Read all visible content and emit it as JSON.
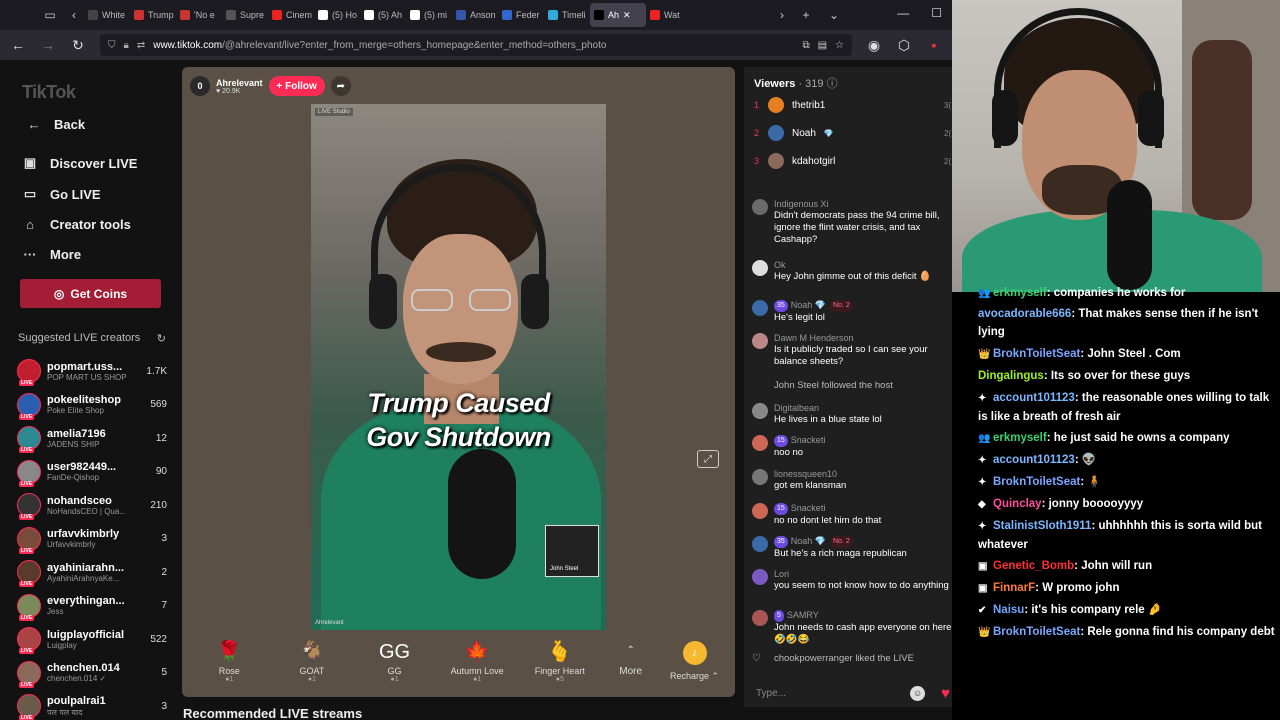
{
  "browser": {
    "tabs": [
      {
        "label": "White",
        "color": "#444"
      },
      {
        "label": "Trump",
        "color": "#c33"
      },
      {
        "label": "'No e",
        "color": "#c33"
      },
      {
        "label": "Supre",
        "color": "#555"
      },
      {
        "label": "Cinem",
        "color": "#e22"
      },
      {
        "label": "(5) Ho",
        "color": "#fff"
      },
      {
        "label": "(5) Ah",
        "color": "#fff"
      },
      {
        "label": "(5) mi",
        "color": "#fff"
      },
      {
        "label": "Anson",
        "color": "#35a"
      },
      {
        "label": "Feder",
        "color": "#36c"
      },
      {
        "label": "Timeli",
        "color": "#3ad"
      },
      {
        "label": "Ah",
        "color": "#000"
      },
      {
        "label": "Wat",
        "color": "#e22"
      }
    ],
    "url_host": "www.tiktok.com",
    "url_path": "/@ahrelevant/live?enter_from_merge=others_homepage&enter_method=others_photo"
  },
  "sidebar": {
    "logo": "TikTok",
    "nav": [
      {
        "label": "Back",
        "icon": "arrow-left-icon",
        "glyph": "←"
      },
      {
        "label": "Discover LIVE",
        "icon": "tv-icon",
        "glyph": "▣"
      },
      {
        "label": "Go LIVE",
        "icon": "camera-icon",
        "glyph": "▭"
      },
      {
        "label": "Creator tools",
        "icon": "house-icon",
        "glyph": "⌂"
      },
      {
        "label": "More",
        "icon": "ellipsis-icon",
        "glyph": "···"
      }
    ],
    "coins_label": "Get Coins",
    "suggested_title": "Suggested LIVE creators",
    "creators": [
      {
        "name": "popmart.uss...",
        "sub": "POP MART US SHOP",
        "count": "1.7K",
        "color": "#c21f2e"
      },
      {
        "name": "pokeeliteshop",
        "sub": "Poke Elite Shop",
        "count": "569",
        "color": "#2a5fb0"
      },
      {
        "name": "amelia7196",
        "sub": "JADENS SHIP",
        "count": "12",
        "color": "#2b8a94"
      },
      {
        "name": "user982449...",
        "sub": "FanDe-Qishop",
        "count": "90",
        "color": "#888"
      },
      {
        "name": "nohandsceo",
        "sub": "NoHandsCEO | Qua...",
        "count": "210",
        "color": "#333"
      },
      {
        "name": "urfavvkimbrly",
        "sub": "Urfavvkimbrly",
        "count": "3",
        "color": "#7a4a3a"
      },
      {
        "name": "ayahiniarahn...",
        "sub": "AyahiniArahnyaKe...",
        "count": "2",
        "color": "#5a3a2a"
      },
      {
        "name": "everythingan...",
        "sub": "Jess",
        "count": "7",
        "color": "#7a8a5a"
      },
      {
        "name": "luigplayofficial",
        "sub": "Luigplay",
        "count": "522",
        "color": "#a44"
      },
      {
        "name": "chenchen.014",
        "sub": "chenchen.014 ✓",
        "count": "5",
        "color": "#8a6a5a"
      },
      {
        "name": "poulpalrai1",
        "sub": "पल पल याद",
        "count": "3",
        "color": "#6a5a4a"
      }
    ]
  },
  "stream": {
    "host_initial": "0",
    "host_name": "Ahrelevant",
    "host_likes": "♥ 20.9K",
    "follow_label": "+ Follow",
    "caption_line1": "Trump Caused",
    "caption_line2": "Gov Shutdown",
    "video_tag": "LIVE Studio",
    "video_tag2": "Ahrelevant",
    "pip_name": "John Steel",
    "gifts": [
      {
        "name": "Rose",
        "icon": "rose-icon",
        "glyph": "🌹",
        "cost": "●1"
      },
      {
        "name": "GOAT",
        "icon": "goat-icon",
        "glyph": "🐐",
        "cost": "●1"
      },
      {
        "name": "GG",
        "icon": "gg-icon",
        "glyph": "GG",
        "cost": "●1"
      },
      {
        "name": "Autumn Love",
        "icon": "autumn-love-icon",
        "glyph": "🍁",
        "cost": "●1"
      },
      {
        "name": "Finger Heart",
        "icon": "finger-heart-icon",
        "glyph": "🫰",
        "cost": "●5"
      }
    ],
    "more_label": "More",
    "recharge_label": "Recharge ⌃",
    "recommended_title": "Recommended LIVE streams"
  },
  "chat": {
    "viewers_label": "Viewers",
    "viewers_count": "· 319",
    "top_viewers": [
      {
        "rank": "1",
        "name": "thetrib1",
        "badge": "",
        "count": "3(",
        "color": "#e67e22"
      },
      {
        "rank": "2",
        "name": "Noah",
        "badge": "💎",
        "count": "2(",
        "color": "#3a6aa8"
      },
      {
        "rank": "3",
        "name": "kdahotgirl",
        "badge": "",
        "count": "2(",
        "color": "#8a6a5a"
      }
    ],
    "messages": [
      {
        "user": "Indigenous Xi",
        "text": "Didn't democrats pass the 94 crime bill, ignore the flint water crisis, and tax Cashapp?",
        "color": "#6a6a6a",
        "badge_lvl": "",
        "badge_no": ""
      },
      {
        "user": "Ok",
        "text": "Hey John gimme out of this deficit 🥚",
        "color": "#ddd",
        "badge_lvl": "",
        "badge_no": ""
      },
      {
        "user": "Noah 💎",
        "text": "He's legit lol",
        "color": "#3a6aa8",
        "badge_lvl": "35",
        "badge_no": "No. 2"
      },
      {
        "user": "Dawn M Henderson",
        "text": "Is it publicly traded so I can see your balance sheets?",
        "color": "#b88",
        "badge_lvl": "",
        "badge_no": ""
      },
      {
        "user": "",
        "text": "John Steel  followed the host",
        "color": "",
        "badge_lvl": "",
        "badge_no": ""
      },
      {
        "user": "Digitalbean",
        "text": "He lives in a blue state lol",
        "color": "#888",
        "badge_lvl": "",
        "badge_no": ""
      },
      {
        "user": "Snacketi",
        "text": "noo no",
        "color": "#c65",
        "badge_lvl": "15",
        "badge_no": ""
      },
      {
        "user": "lionessqueen10",
        "text": "got em klansman",
        "color": "#777",
        "badge_lvl": "",
        "badge_no": ""
      },
      {
        "user": "Snacketi",
        "text": "no no dont let him do that",
        "color": "#c65",
        "badge_lvl": "15",
        "badge_no": ""
      },
      {
        "user": "Noah 💎",
        "text": "But he's a rich maga republican",
        "color": "#3a6aa8",
        "badge_lvl": "35",
        "badge_no": "No. 2"
      },
      {
        "user": "Lori",
        "text": "you seem to not know how to do anything",
        "color": "#7a5ac0",
        "badge_lvl": "",
        "badge_no": ""
      },
      {
        "user": "SAMRY",
        "text": "John needs to cash app everyone on here 🤣🤣😂",
        "color": "#a55",
        "badge_lvl": "5",
        "badge_no": ""
      },
      {
        "user": "",
        "text": "chookpowerranger liked the LIVE",
        "color": "",
        "badge_lvl": "",
        "badge_no": ""
      }
    ],
    "input_placeholder": "Type..."
  },
  "twitch_chat": [
    {
      "icon": "👥",
      "name": "erkmyself",
      "name_color": "#3bd16f",
      "text": ": companies he works for"
    },
    {
      "icon": "",
      "name": "avocadorable666",
      "name_color": "#7ab8ff",
      "text": ": That makes sense then if he isn't lying"
    },
    {
      "icon": "👑",
      "name": "BroknToiletSeat",
      "name_color": "#7aa7ff",
      "text": ": John Steel . Com"
    },
    {
      "icon": "",
      "name": "Dingalingus",
      "name_color": "#9ef01a",
      "text": ": Its so over for these guys"
    },
    {
      "icon": "✦",
      "name": "account101123",
      "name_color": "#7ab8ff",
      "text": ": the reasonable ones willing to talk is like a breath of fresh air"
    },
    {
      "icon": "👥",
      "name": "erkmyself",
      "name_color": "#3bd16f",
      "text": ": he just said he owns a company"
    },
    {
      "icon": "✦",
      "name": "account101123",
      "name_color": "#7ab8ff",
      "text": ": 👽"
    },
    {
      "icon": "✦",
      "name": "BroknToiletSeat",
      "name_color": "#7aa7ff",
      "text": ": 🧍"
    },
    {
      "icon": "◆",
      "name": "Quinclay",
      "name_color": "#ff4f9a",
      "text": ": jonny booooyyyy"
    },
    {
      "icon": "✦",
      "name": "StalinistSloth1911",
      "name_color": "#7ab8ff",
      "text": ": uhhhhhh this is sorta wild but whatever"
    },
    {
      "icon": "▣",
      "name": "Genetic_Bomb",
      "name_color": "#ff3030",
      "text": ": John will run"
    },
    {
      "icon": "▣",
      "name": "FinnarF",
      "name_color": "#ff7a3a",
      "text": ": W promo john"
    },
    {
      "icon": "✔",
      "name": "Naisu",
      "name_color": "#6fa8ff",
      "text": ": it's his company rele 🤌"
    },
    {
      "icon": "👑",
      "name": "BroknToiletSeat",
      "name_color": "#7aa7ff",
      "text": ": Rele gonna find his company debt"
    }
  ]
}
